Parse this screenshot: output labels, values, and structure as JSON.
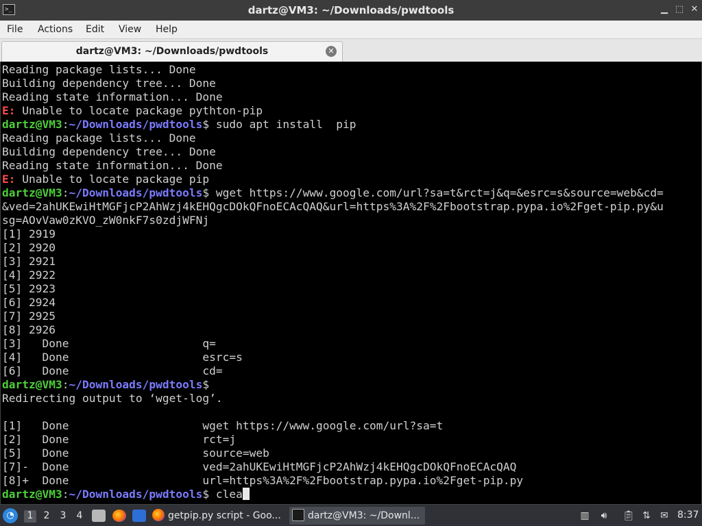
{
  "window": {
    "title": "dartz@VM3: ~/Downloads/pwdtools",
    "minimize_glyph": "▁",
    "maximize_glyph": "⬚",
    "close_glyph": "✕"
  },
  "menu": {
    "items": [
      "File",
      "Actions",
      "Edit",
      "View",
      "Help"
    ]
  },
  "tabs": [
    {
      "label": "dartz@VM3: ~/Downloads/pwdtools",
      "close_glyph": "✕"
    }
  ],
  "terminal": {
    "prompt_user": "dartz@VM3",
    "prompt_sep": ":",
    "prompt_path": "~/Downloads/pwdtools",
    "prompt_end": "$",
    "error_prefix": "E:",
    "lines": [
      {
        "kind": "text",
        "text": "Reading package lists... Done"
      },
      {
        "kind": "text",
        "text": "Building dependency tree... Done"
      },
      {
        "kind": "text",
        "text": "Reading state information... Done"
      },
      {
        "kind": "error",
        "text": " Unable to locate package pythton-pip"
      },
      {
        "kind": "prompt",
        "text": " sudo apt install  pip"
      },
      {
        "kind": "text",
        "text": "Reading package lists... Done"
      },
      {
        "kind": "text",
        "text": "Building dependency tree... Done"
      },
      {
        "kind": "text",
        "text": "Reading state information... Done"
      },
      {
        "kind": "error",
        "text": " Unable to locate package pip"
      },
      {
        "kind": "prompt",
        "text": " wget https://www.google.com/url?sa=t&rct=j&q=&esrc=s&source=web&cd="
      },
      {
        "kind": "text",
        "text": "&ved=2ahUKEwiHtMGFjcP2AhWzj4kEHQgcDOkQFnoECAcQAQ&url=https%3A%2F%2Fbootstrap.pypa.io%2Fget-pip.py&u"
      },
      {
        "kind": "text",
        "text": "sg=AOvVaw0zKVO_zW0nkF7s0zdjWFNj"
      },
      {
        "kind": "text",
        "text": "[1] 2919"
      },
      {
        "kind": "text",
        "text": "[2] 2920"
      },
      {
        "kind": "text",
        "text": "[3] 2921"
      },
      {
        "kind": "text",
        "text": "[4] 2922"
      },
      {
        "kind": "text",
        "text": "[5] 2923"
      },
      {
        "kind": "text",
        "text": "[6] 2924"
      },
      {
        "kind": "text",
        "text": "[7] 2925"
      },
      {
        "kind": "text",
        "text": "[8] 2926"
      },
      {
        "kind": "text",
        "text": "[3]   Done                    q="
      },
      {
        "kind": "text",
        "text": "[4]   Done                    esrc=s"
      },
      {
        "kind": "text",
        "text": "[6]   Done                    cd="
      },
      {
        "kind": "prompt",
        "text": ""
      },
      {
        "kind": "text",
        "text": "Redirecting output to ‘wget-log’."
      },
      {
        "kind": "text",
        "text": ""
      },
      {
        "kind": "text",
        "text": "[1]   Done                    wget https://www.google.com/url?sa=t"
      },
      {
        "kind": "text",
        "text": "[2]   Done                    rct=j"
      },
      {
        "kind": "text",
        "text": "[5]   Done                    source=web"
      },
      {
        "kind": "text",
        "text": "[7]-  Done                    ved=2ahUKEwiHtMGFjcP2AhWzj4kEHQgcDOkQFnoECAcQAQ"
      },
      {
        "kind": "text",
        "text": "[8]+  Done                    url=https%3A%2F%2Fbootstrap.pypa.io%2Fget-pip.py"
      },
      {
        "kind": "prompt",
        "text": " clea",
        "cursor": true
      }
    ],
    "colors": {
      "background": "#000000",
      "foreground": "#d0d0d0",
      "user": "#4ece3a",
      "path": "#7b7bff",
      "error": "#ff4b4b"
    }
  },
  "taskbar": {
    "start_icon": "start-menu-icon",
    "workspaces": [
      "1",
      "2",
      "3",
      "4"
    ],
    "active_workspace": "1",
    "launchers": [
      "file-manager-icon",
      "firefox-icon",
      "show-desktop-icon"
    ],
    "tasks": [
      {
        "label": "getpip.py script - Goo...",
        "icon": "firefox-icon",
        "active": false
      },
      {
        "label": "dartz@VM3: ~/Downl...",
        "icon": "terminal-icon",
        "active": true
      }
    ],
    "tray": [
      "trash-icon",
      "volume-icon",
      "clipboard-icon",
      "network-icon",
      "notification-icon",
      "keyboard-icon"
    ],
    "clock": "8:37"
  }
}
